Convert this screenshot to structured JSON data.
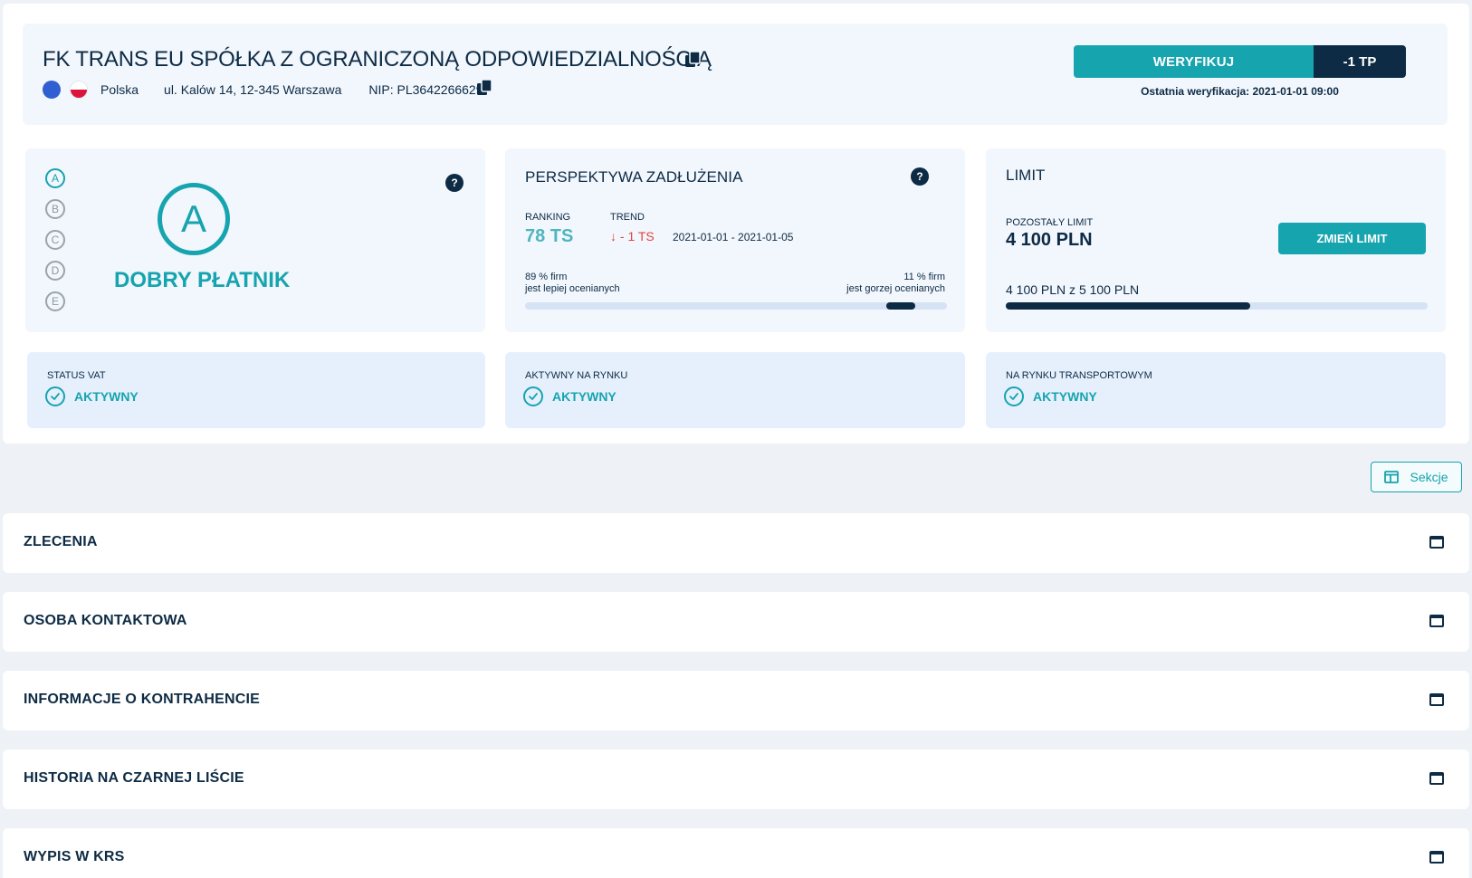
{
  "company": {
    "name": "FK TRANS EU SPÓŁKA Z OGRANICZONĄ ODPOWIEDZIALNOŚCIĄ",
    "country": "Polska",
    "address": "ul. Kalów 14, 12-345 Warszawa",
    "nip": "NIP: PL3642266629"
  },
  "verification": {
    "button_label": "WERYFIKUJ",
    "cost_label": "-1 TP",
    "last_verification": "Ostatnia weryfikacja: 2021-01-01 09:00"
  },
  "rating": {
    "grades": [
      "A",
      "B",
      "C",
      "D",
      "E"
    ],
    "active_grade": "A",
    "label": "DOBRY PŁATNIK",
    "help": "?"
  },
  "debt_outlook": {
    "title": "PERSPEKTYWA ZADŁUŻENIA",
    "help": "?",
    "ranking_label": "RANKING",
    "ranking_value": "78 TS",
    "trend_label": "TREND",
    "trend_value": "↓ - 1 TS",
    "trend_dates": "2021-01-01 - 2021-01-05",
    "left_pct_line1": "89 % firm",
    "left_pct_line2": "jest lepiej ocenianych",
    "right_pct_line1": "11 % firm",
    "right_pct_line2": "jest gorzej ocenianych",
    "better_share": 0.89
  },
  "limit": {
    "title": "LIMIT",
    "remaining_label": "POZOSTAŁY LIMIT",
    "remaining_value": "4 100 PLN",
    "change_button": "ZMIEŃ LIMIT",
    "summary": "4 100 PLN z 5 100 PLN",
    "used_fraction": 0.58
  },
  "statuses": [
    {
      "label": "STATUS VAT",
      "value": "AKTYWNY"
    },
    {
      "label": "AKTYWNY NA RYNKU",
      "value": "AKTYWNY"
    },
    {
      "label": "NA RYNKU TRANSPORTOWYM",
      "value": "AKTYWNY"
    }
  ],
  "sections_button": "Sekcje",
  "sections": [
    {
      "title": "ZLECENIA"
    },
    {
      "title": "OSOBA KONTAKTOWA"
    },
    {
      "title": "INFORMACJE O KONTRAHENCIE"
    },
    {
      "title": "HISTORIA NA CZARNEJ LIŚCIE"
    },
    {
      "title": "WYPIS W KRS"
    }
  ],
  "colors": {
    "accent": "#16a4ae",
    "navy": "#0d2b44",
    "trend_down": "#e0453e"
  }
}
